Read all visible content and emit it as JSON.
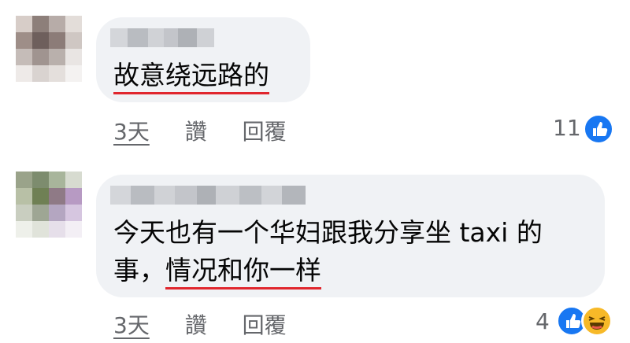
{
  "comments": [
    {
      "text_line1": "故意绕远路的",
      "time": "3天",
      "like_label": "讚",
      "reply_label": "回覆",
      "reaction_count": "11",
      "reactions": [
        "like-icon"
      ]
    },
    {
      "text_line1": "今天也有一个华妇跟我分享坐 taxi 的",
      "text_line2_prefix": "事，",
      "text_line2_underlined": "情况和你一样",
      "time": "3天",
      "like_label": "讚",
      "reply_label": "回覆",
      "reaction_count": "4",
      "reactions": [
        "like-icon",
        "haha-icon"
      ]
    }
  ],
  "colors": {
    "bubble": "#f0f2f5",
    "underline": "#e0262d",
    "meta": "#65676b",
    "like": "#1877f2",
    "haha": "#f7b928"
  }
}
